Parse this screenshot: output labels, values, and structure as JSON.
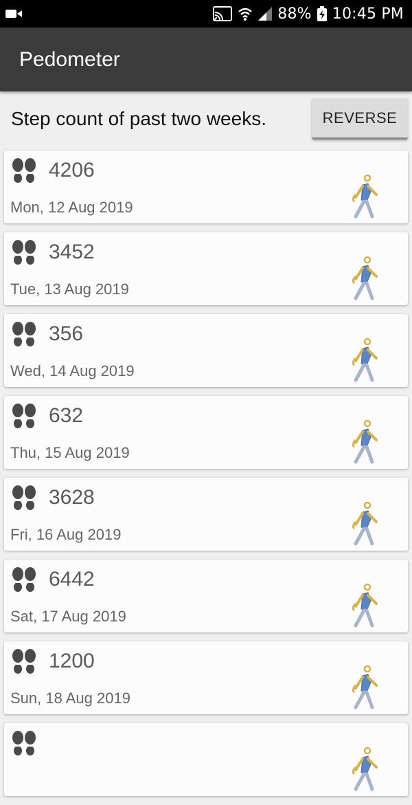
{
  "status_bar": {
    "battery": "88%",
    "time": "10:45 PM"
  },
  "app_bar": {
    "title": "Pedometer"
  },
  "subheader": {
    "text": "Step count of past two weeks.",
    "reverse_label": "REVERSE"
  },
  "icons": {
    "steps": "footprints-icon",
    "activity": "walking-person-icon"
  },
  "entries": [
    {
      "steps": "4206",
      "date": "Mon, 12 Aug 2019"
    },
    {
      "steps": "3452",
      "date": "Tue, 13 Aug 2019"
    },
    {
      "steps": "356",
      "date": "Wed, 14 Aug 2019"
    },
    {
      "steps": "632",
      "date": "Thu, 15 Aug 2019"
    },
    {
      "steps": "3628",
      "date": "Fri, 16 Aug 2019"
    },
    {
      "steps": "6442",
      "date": "Sat, 17 Aug 2019"
    },
    {
      "steps": "1200",
      "date": "Sun, 18 Aug 2019"
    },
    {
      "steps": "",
      "date": ""
    }
  ]
}
